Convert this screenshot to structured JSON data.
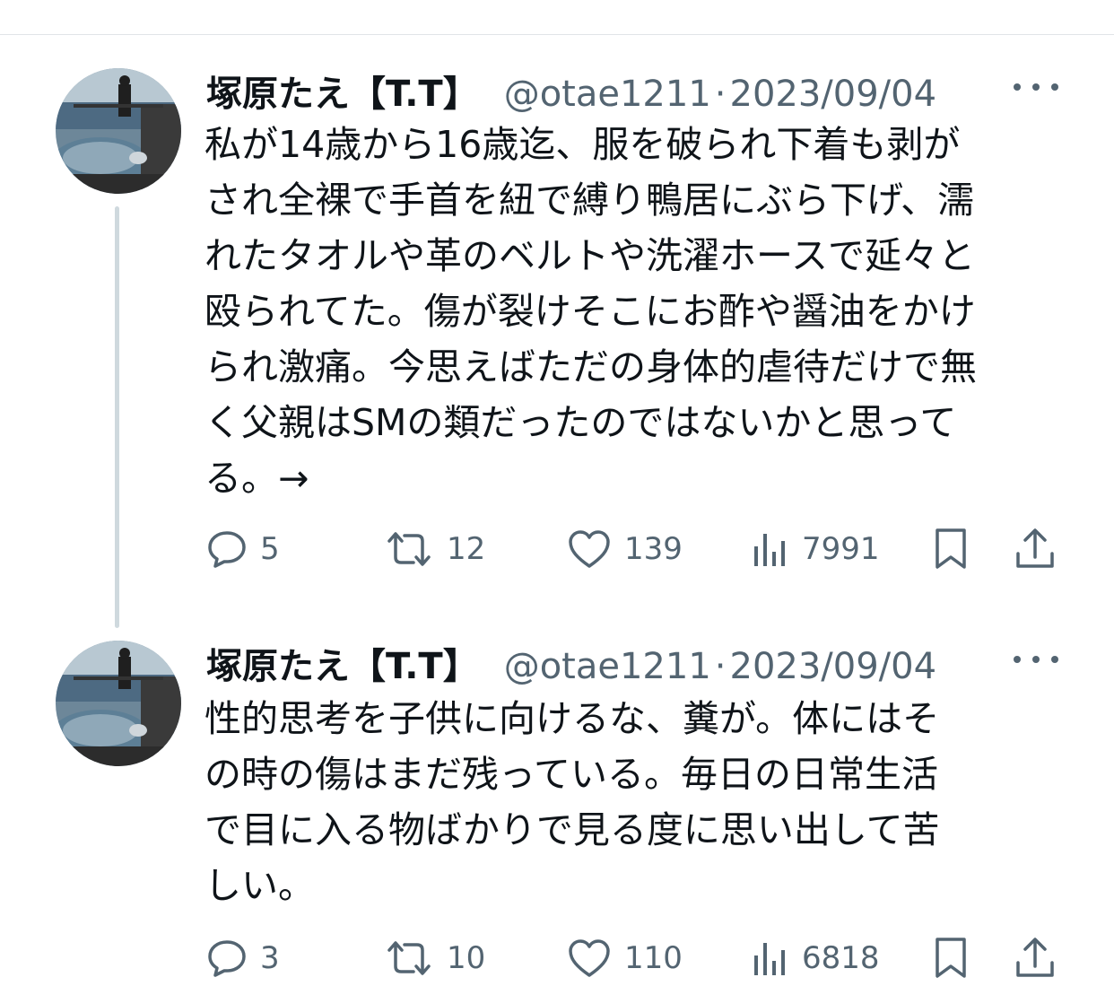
{
  "tweets": [
    {
      "author": {
        "display_name": "塚原たえ【T.T】",
        "handle": "@otae1211"
      },
      "separator": "·",
      "date": "2023/09/04",
      "text": "私が14歳から16歳迄、服を破られ下着も剥が\nされ全裸で手首を紐で縛り鴨居にぶら下げ、濡\nれたタオルや革のベルトや洗濯ホースで延々と\n殴られてた。傷が裂けそこにお酢や醤油をかけ\nられ激痛。今思えばただの身体的虐待だけで無\nく父親はSMの類だったのではないかと思って\nる。→",
      "stats": {
        "replies": "5",
        "reposts": "12",
        "likes": "139",
        "views": "7991"
      }
    },
    {
      "author": {
        "display_name": "塚原たえ【T.T】",
        "handle": "@otae1211"
      },
      "separator": "·",
      "date": "2023/09/04",
      "text": "性的思考を子供に向けるな、糞が。体にはそ\nの時の傷はまだ残っている。毎日の日常生活\nで目に入る物ばかりで見る度に思い出して苦\nしい。",
      "stats": {
        "replies": "3",
        "reposts": "10",
        "likes": "110",
        "views": "6818"
      }
    }
  ],
  "icons": {
    "reply": "speech-bubble-icon",
    "repost": "repost-arrows-icon",
    "like": "heart-outline-icon",
    "views": "bar-chart-icon",
    "bookmark": "bookmark-icon",
    "share": "share-upload-icon",
    "more": "three-dots-icon"
  },
  "colors": {
    "text": "#0f1419",
    "secondary": "#536471",
    "thread_line": "#cfd9de"
  }
}
